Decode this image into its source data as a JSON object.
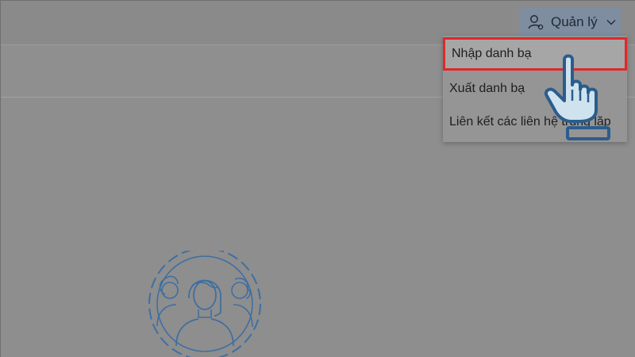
{
  "header": {
    "manage_button": {
      "label": "Quản lý",
      "icon": "person-settings-icon",
      "chevron_icon": "chevron-down-icon"
    }
  },
  "dropdown_menu": {
    "items": [
      {
        "label": "Nhập danh bạ",
        "highlighted": true
      },
      {
        "label": "Xuất danh bạ"
      },
      {
        "label": "Liên kết các liên hệ trùng lặp"
      }
    ]
  },
  "annotations": {
    "highlight_color": "#e0282a",
    "pointer_icon": "hand-pointer-icon"
  },
  "main": {
    "empty_state_icon": "people-group-icon"
  },
  "colors": {
    "overlay_gray": "#8e8e8e",
    "manage_button_bg": "#7e8da0",
    "illustration_stroke": "#3f6fa0"
  }
}
